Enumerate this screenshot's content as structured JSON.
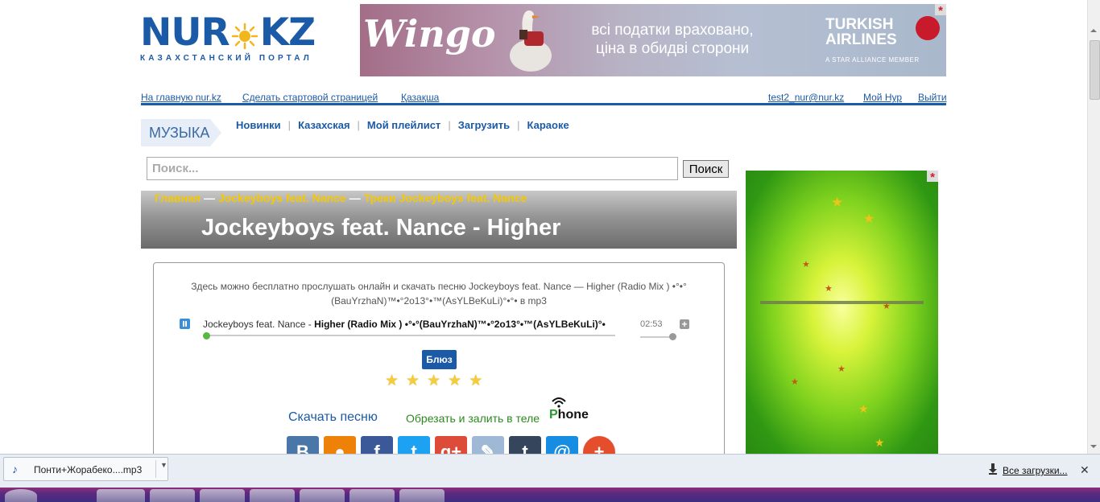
{
  "logo": {
    "name_left": "NUR",
    "name_right": "KZ",
    "tagline": "КАЗАХСТАНСКИЙ ПОРТАЛ"
  },
  "banner": {
    "brand": "Wingo",
    "line1": "всі податки враховано,",
    "line2": "ціна в обидві сторони",
    "airline_line1": "TURKISH",
    "airline_line2": "AIRLINES",
    "alliance": "A STAR ALLIANCE MEMBER",
    "close": "*"
  },
  "topnav": {
    "home": "На главную nur.kz",
    "start_page": "Сделать стартовой страницей",
    "kazakh": "Қазақша",
    "user": "test2_nur@nur.kz",
    "my": "Мой Нур",
    "logout": "Выйти"
  },
  "section": {
    "title": "МУЗЫКА"
  },
  "musicnav": [
    "Новинки",
    "Казахская",
    "Мой плейлист",
    "Загрузить",
    "Караоке"
  ],
  "search": {
    "placeholder": "Поиск...",
    "button": "Поиск"
  },
  "breadcrumbs": {
    "home": "Главная",
    "sep": "—",
    "artist": "Jockeyboys feat. Nance",
    "tracks": "Треки Jockeyboys feat. Nance"
  },
  "page_title": "Jockeyboys feat. Nance - Higher",
  "description": "Здесь можно бесплатно прослушать онлайн и скачать песню Jockeyboys feat. Nance — Higher (Radio Mix ) •°•°(BauYrzhaN)™•°2o13°•™(AsYLBeKuLi)°•°• в mp3",
  "player": {
    "artist": "Jockeyboys feat. Nance - ",
    "title": "Higher (Radio Mix ) •°•°(BauYrzhaN)™•°2o13°•™(AsYLBeKuLi)°•",
    "duration": "02:53",
    "progress": 0
  },
  "genre": "Блюз",
  "rating": {
    "stars": 5
  },
  "actions": {
    "download": "Скачать песню",
    "cut": "Обрезать и залить в теле",
    "phone_p": "P",
    "phone_rest": "hone"
  },
  "social": [
    {
      "icon": "vk-icon",
      "glyph": "B",
      "color": "#4a76a8"
    },
    {
      "icon": "odnoklassniki-icon",
      "glyph": "●",
      "color": "#ee8208"
    },
    {
      "icon": "facebook-icon",
      "glyph": "f",
      "color": "#3b5998"
    },
    {
      "icon": "twitter-icon",
      "glyph": "t",
      "color": "#1da1f2"
    },
    {
      "icon": "googleplus-icon",
      "glyph": "g+",
      "color": "#dd4b39"
    },
    {
      "icon": "livejournal-icon",
      "glyph": "✎",
      "color": "#9fb8d6"
    },
    {
      "icon": "tumblr-icon",
      "glyph": "t",
      "color": "#35465c"
    },
    {
      "icon": "mailru-icon",
      "glyph": "@",
      "color": "#168de2"
    },
    {
      "icon": "more-icon",
      "glyph": "+",
      "color": "#e44e2d"
    }
  ],
  "side_ad": {
    "close": "*"
  },
  "download_shelf": {
    "file": "Понти+Жорабеко....mp3",
    "all_downloads": "Все загрузки...",
    "close": "✕"
  }
}
